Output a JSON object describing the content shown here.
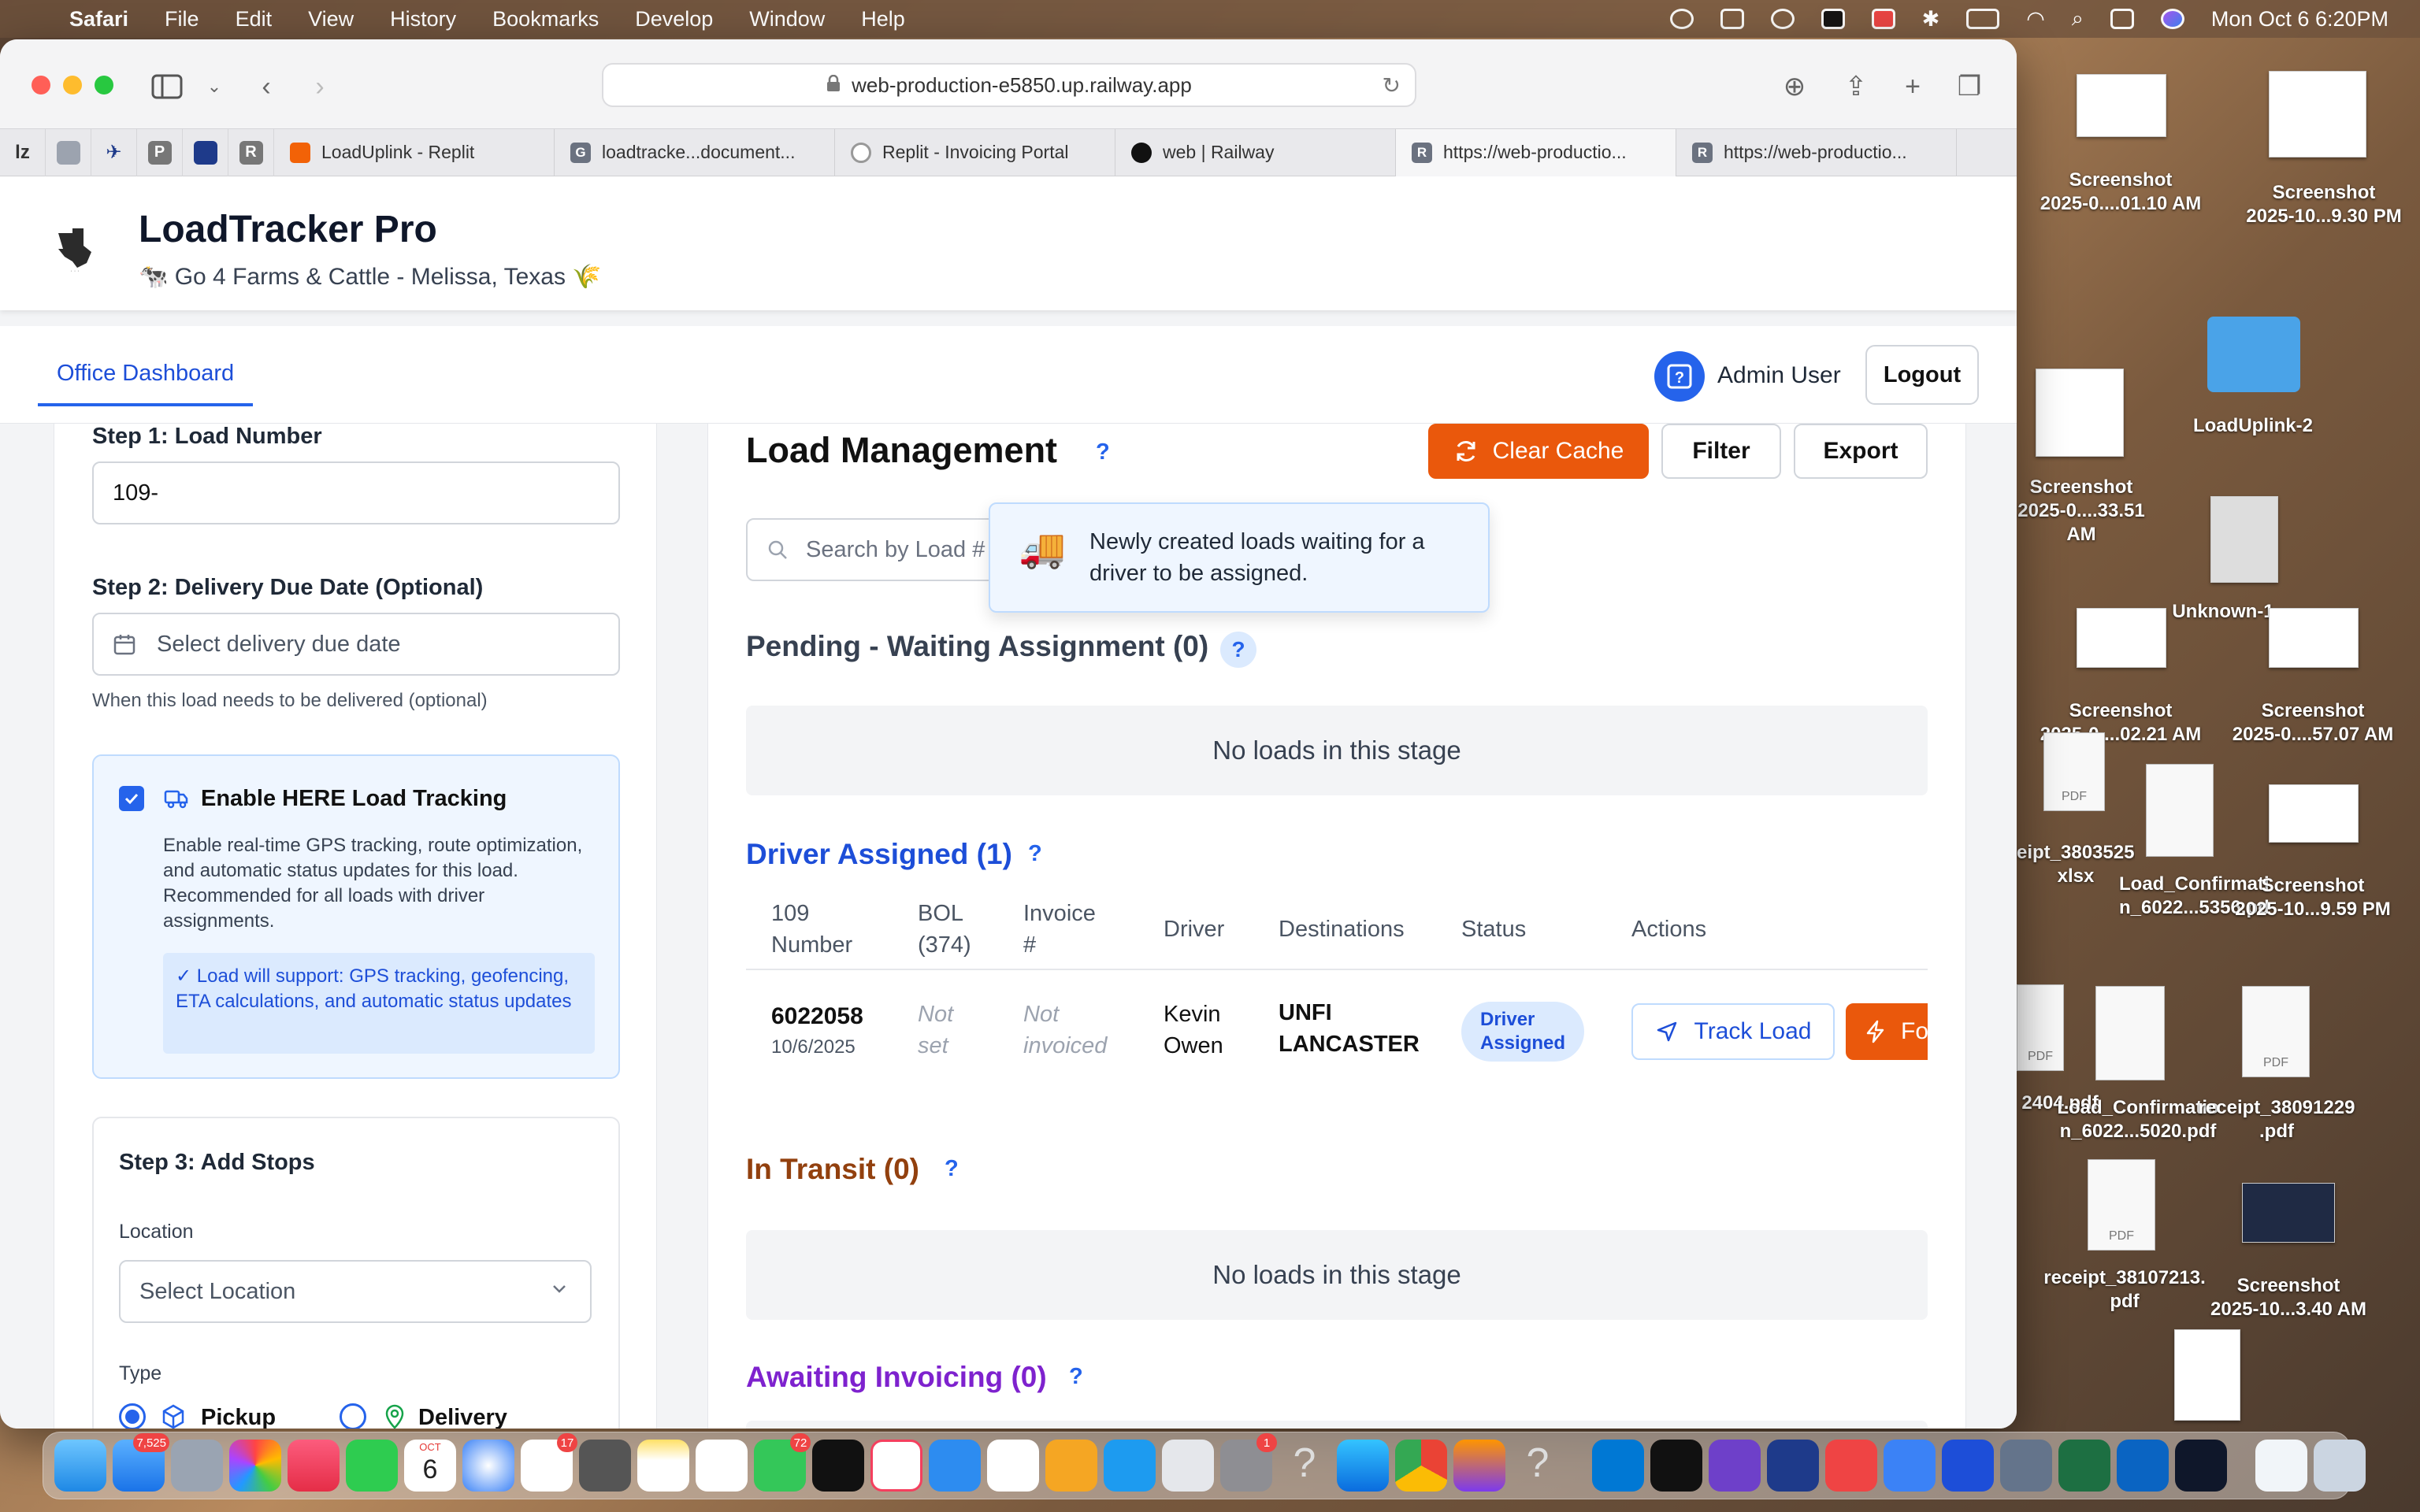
{
  "menubar": {
    "app": "Safari",
    "items": [
      "File",
      "Edit",
      "View",
      "History",
      "Bookmarks",
      "Develop",
      "Window",
      "Help"
    ],
    "datetime": "Mon Oct 6  6:20PM"
  },
  "browser": {
    "url": "web-production-e5850.up.railway.app",
    "pinned": [
      "lz",
      "",
      "",
      "P",
      "",
      "R"
    ],
    "tabs": [
      {
        "title": "LoadUplink - Replit",
        "fav": "R",
        "color": "#f26207"
      },
      {
        "title": "loadtracke...document...",
        "fav": "G",
        "color": "#6b7280"
      },
      {
        "title": "Replit - Invoicing Portal",
        "fav": "",
        "color": "#cccccc"
      },
      {
        "title": "web | Railway",
        "fav": "",
        "color": "#111111"
      },
      {
        "title": "https://web-productio...",
        "fav": "R",
        "color": "#6b7280"
      },
      {
        "title": "https://web-productio...",
        "fav": "R",
        "color": "#6b7280"
      }
    ]
  },
  "app": {
    "title": "LoadTracker Pro",
    "subtitle": "🐄 Go 4 Farms & Cattle - Melissa, Texas 🌾",
    "nav_tab": "Office Dashboard",
    "user": "Admin User",
    "logout": "Logout"
  },
  "form": {
    "step1_label": "Step 1: Load Number",
    "load_number": "109-",
    "step2_label": "Step 2: Delivery Due Date (Optional)",
    "due_date_placeholder": "Select delivery due date",
    "due_date_hint": "When this load needs to be delivered (optional)",
    "tracking_title": "Enable HERE Load Tracking",
    "tracking_checked": true,
    "tracking_desc": "Enable real-time GPS tracking, route optimization, and automatic status updates for this load. Recommended for all loads with driver assignments.",
    "tracking_note": "✓ Load will support: GPS tracking, geofencing, ETA calculations, and automatic status updates",
    "step3_label": "Step 3: Add Stops",
    "location_label": "Location",
    "location_placeholder": "Select Location",
    "type_label": "Type",
    "type_pickup": "Pickup",
    "type_delivery": "Delivery"
  },
  "loads": {
    "title": "Load Management",
    "help": "?",
    "clear_cache": "Clear Cache",
    "filter": "Filter",
    "export": "Export",
    "search_placeholder": "Search by Load #",
    "tooltip_icon": "🚚",
    "tooltip": "Newly created loads waiting for a driver to be assigned.",
    "empty_text": "No loads in this stage",
    "pending_title": "Pending - Waiting Assignment (0)",
    "assigned_title": "Driver Assigned (1)",
    "transit_title": "In Transit (0)",
    "invoicing_title": "Awaiting Invoicing (0)",
    "colors": {
      "assigned": "#1d4ed8",
      "transit": "#92400e",
      "invoicing": "#7e22ce",
      "accent": "#ea580c"
    },
    "columns": [
      "109 Number",
      "BOL (374)",
      "Invoice #",
      "Driver",
      "Destinations",
      "Status",
      "Actions"
    ],
    "row": {
      "number": "6022058",
      "date": "10/6/2025",
      "bol": "Not set",
      "invoice": "Not invoiced",
      "driver": "Kevin Owen",
      "destination": "UNFI LANCASTER",
      "status": "Driver Assigned",
      "track": "Track Load",
      "force": "Fo"
    }
  },
  "desktop": [
    {
      "label": "Screenshot\n2025-0....01.10 AM"
    },
    {
      "label": "Screenshot\n2025-10...9.30 PM"
    },
    {
      "label": "LoadUplink-2"
    },
    {
      "label": "Screenshot\n2025-0....33.51 AM"
    },
    {
      "label": "Unknown-1"
    },
    {
      "label": "Screenshot\n2025-0....02.21 AM"
    },
    {
      "label": "Screenshot\n2025-0....57.07 AM"
    },
    {
      "label": "eipt_38035258\nxlsx"
    },
    {
      "label": "Load_Confirmatio\nn_6022...5356.pdf"
    },
    {
      "label": "Screenshot\n2025-10...9.59 PM"
    },
    {
      "label": "2404.pdf"
    },
    {
      "label": "Load_Confirmatio\nn_6022...5020.pdf"
    },
    {
      "label": "receipt_38091229\n.pdf"
    },
    {
      "label": "receipt_38107213.\npdf"
    },
    {
      "label": "Screenshot\n2025-10...3.40 AM"
    }
  ],
  "dock": {
    "mail_badge": "7,525",
    "messages_badge": "72",
    "reminders_badge": "17",
    "settings_badge": "1",
    "calendar_month": "OCT",
    "calendar_day": "6"
  }
}
